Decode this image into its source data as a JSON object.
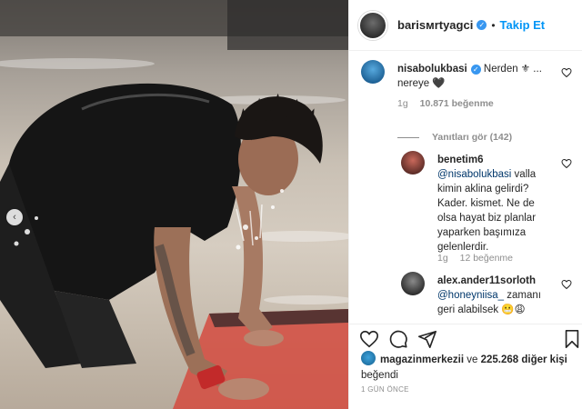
{
  "post": {
    "image_alt": "Man crawling on wet slippery surface",
    "carousel_indicator_icon": "arrow-left"
  },
  "header": {
    "username": "barisмrtyagci",
    "verified_icon": "verified-badge-icon",
    "separator": "•",
    "follow_label": "Takip Et"
  },
  "comments": [
    {
      "username": "nisabolukbasi",
      "verified": true,
      "text": "Nerden ⚜ ... nereye 🖤",
      "time": "1g",
      "likes": "10.871 beğenme",
      "view_replies": "Yanıtları gör (142)"
    },
    {
      "username": "benetim6",
      "mention": "@nisabolukbasi",
      "text": " valla kimin aklina gelirdi? Kader. kismet. Ne de olsa hayat biz planlar yaparken başımıza gelenlerdir.",
      "time": "1g",
      "likes": "12 beğenme"
    },
    {
      "username": "alex.ander11sorloth",
      "mention": "@honeyniisa_",
      "text": " zamanı geri alabilsek 😬😩"
    }
  ],
  "actions": {
    "like_icon": "heart-icon",
    "comment_icon": "comment-icon",
    "share_icon": "share-icon",
    "save_icon": "bookmark-icon"
  },
  "likes_summary": {
    "first_user": "magazinmerkezii",
    "connector": " ve ",
    "others": "225.268 diğer kişi",
    "suffix": " beğendi"
  },
  "timestamp": "1 gün önce",
  "colors": {
    "link_blue": "#0095f6",
    "verified_blue": "#3897f0",
    "muted": "#8e8e8e",
    "text": "#262626"
  }
}
